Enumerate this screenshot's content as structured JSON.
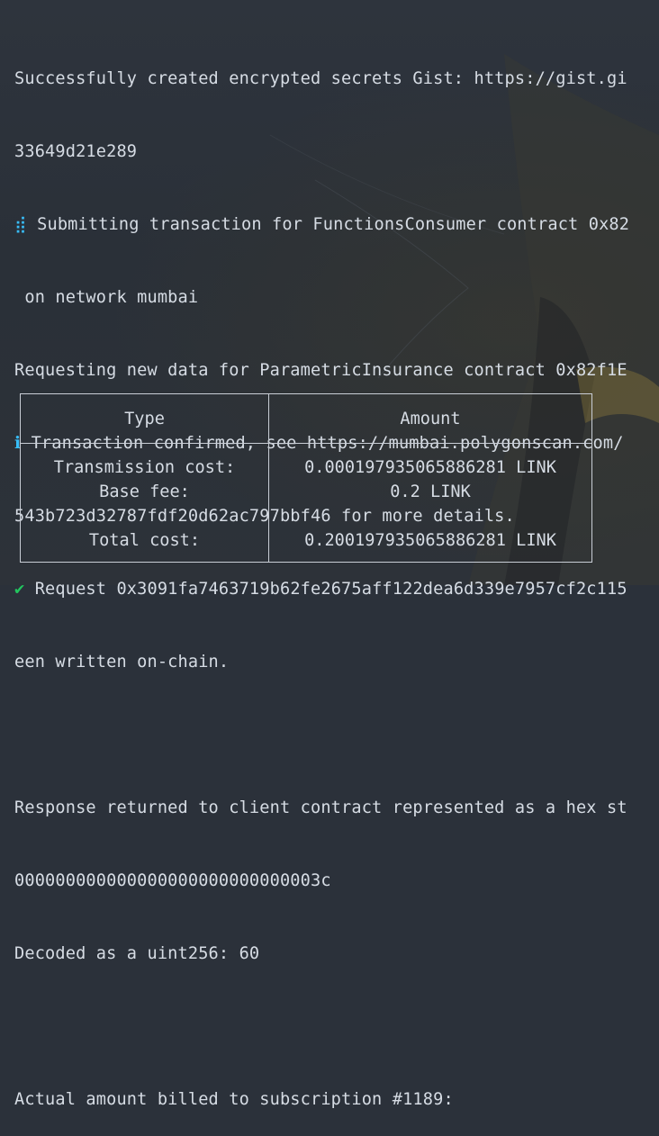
{
  "terminal": {
    "lines": [
      {
        "prefix": "",
        "text": "Successfully created encrypted secrets Gist: https://gist.gi"
      },
      {
        "prefix": "",
        "text": "33649d21e289"
      },
      {
        "prefix": "spinner",
        "text": " Submitting transaction for FunctionsConsumer contract 0x82"
      },
      {
        "prefix": "",
        "text": " on network mumbai"
      },
      {
        "prefix": "",
        "text": "Requesting new data for ParametricInsurance contract 0x82f1E"
      },
      {
        "prefix": "info",
        "text": " Transaction confirmed, see https://mumbai.polygonscan.com/"
      },
      {
        "prefix": "",
        "text": "543b723d32787fdf20d62ac797bbf46 for more details."
      },
      {
        "prefix": "check",
        "text": " Request 0x3091fa7463719b62fe2675aff122dea6d339e7957cf2c115"
      },
      {
        "prefix": "",
        "text": "een written on-chain."
      },
      {
        "prefix": "",
        "text": ""
      },
      {
        "prefix": "",
        "text": "Response returned to client contract represented as a hex st"
      },
      {
        "prefix": "",
        "text": "000000000000000000000000000003c"
      },
      {
        "prefix": "",
        "text": "Decoded as a uint256: 60"
      },
      {
        "prefix": "",
        "text": ""
      },
      {
        "prefix": "",
        "text": "Actual amount billed to subscription #1189:"
      }
    ],
    "icons": {
      "spinner": "⣾",
      "info": "ℹ",
      "check": "✔"
    }
  },
  "billing_table": {
    "headers": {
      "type": "Type",
      "amount": "Amount"
    },
    "rows": [
      {
        "type": "Transmission cost:",
        "amount": "0.000197935065886281 LINK"
      },
      {
        "type": "Base fee:",
        "amount": "0.2 LINK"
      },
      {
        "type": "",
        "amount": ""
      },
      {
        "type": "Total cost:",
        "amount": "0.200197935065886281 LINK"
      }
    ]
  },
  "colors": {
    "background": "#2b313a",
    "text": "#d6dce4",
    "spinner": "#38bdf8",
    "info": "#38bdf8",
    "success": "#22c55e"
  }
}
